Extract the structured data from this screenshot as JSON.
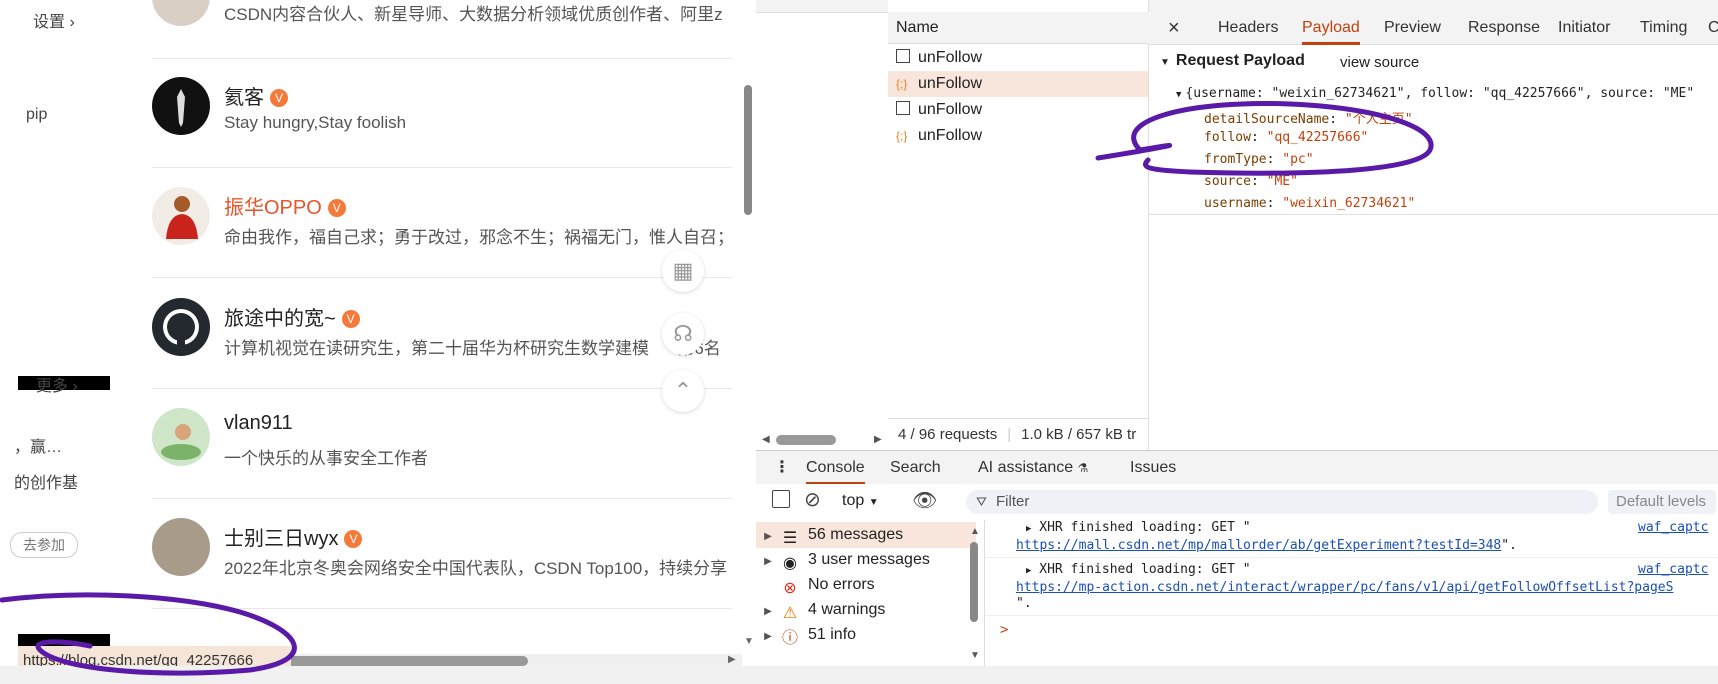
{
  "left_panel": {
    "settings_label": "设置",
    "pip_label": "pip",
    "more_label": "更多",
    "promo_text": "，赢…",
    "creation_text": "的创作基",
    "join_button": "去参加",
    "top_cut_text": "CSDN内容合伙人、新星导师、大数据分析领域优质创作者、阿里z"
  },
  "users": [
    {
      "name": "氦客",
      "desc": "Stay hungry,Stay foolish",
      "verified": true,
      "highlight": false
    },
    {
      "name": "振华OPPO",
      "desc": "命由我作，福自己求；勇于改过，邪念不生；祸福无门，惟人自召；",
      "verified": true,
      "highlight": true
    },
    {
      "name": "旅途中的宽~",
      "desc": "计算机视觉在读研究生，第二十届华为杯研究生数学建模",
      "desc_suffix": "第6名",
      "verified": true,
      "highlight": false
    },
    {
      "name": "vlan911",
      "desc": "一个快乐的从事安全工作者",
      "verified": false,
      "highlight": false
    },
    {
      "name": "士别三日wyx",
      "desc": "2022年北京冬奥会网络安全中国代表队，CSDN Top100，持续分享",
      "verified": true,
      "highlight": false
    }
  ],
  "status_url": "https://blog.csdn.net/qq_42257666",
  "devtools": {
    "network": {
      "name_header": "Name",
      "requests": [
        {
          "name": "unFollow",
          "type": "doc"
        },
        {
          "name": "unFollow",
          "type": "xhr"
        },
        {
          "name": "unFollow",
          "type": "doc"
        },
        {
          "name": "unFollow",
          "type": "xhr"
        }
      ],
      "footer_requests": "4 / 96 requests",
      "footer_size": "1.0 kB / 657 kB tr"
    },
    "detail_tabs": [
      "Headers",
      "Payload",
      "Preview",
      "Response",
      "Initiator",
      "Timing",
      "C"
    ],
    "active_detail_tab": "Payload",
    "payload": {
      "title": "Request Payload",
      "view_source": "view source",
      "summary": "{username: \"weixin_62734621\", follow: \"qq_42257666\", source: \"ME\"",
      "fields": [
        {
          "key": "detailSourceName",
          "value": "\"个人主页\""
        },
        {
          "key": "follow",
          "value": "\"qq_42257666\""
        },
        {
          "key": "fromType",
          "value": "\"pc\""
        },
        {
          "key": "source",
          "value": "\"ME\""
        },
        {
          "key": "username",
          "value": "\"weixin_62734621\""
        }
      ]
    },
    "console": {
      "tabs": [
        "Console",
        "Search",
        "AI assistance",
        "Issues"
      ],
      "context": "top",
      "filter_placeholder": "Filter",
      "default_levels": "Default levels",
      "sidebar": [
        {
          "label": "56 messages",
          "icon": "list-icon"
        },
        {
          "label": "3 user messages",
          "icon": "user-icon"
        },
        {
          "label": "No errors",
          "icon": "error-icon"
        },
        {
          "label": "4 warnings",
          "icon": "warning-icon"
        },
        {
          "label": "51 info",
          "icon": "info-icon"
        }
      ],
      "logs": [
        {
          "text": "XHR finished loading: GET \"",
          "url": "https://mall.csdn.net/mp/mallorder/ab/getExperiment?testId=348",
          "suffix": "\".",
          "source": "waf_captc"
        },
        {
          "text": "XHR finished loading: GET \"",
          "url": "https://mp-action.csdn.net/interact/wrapper/pc/fans/v1/api/getFollowOffsetList?pageS",
          "suffix": "\".",
          "source": "waf_captc"
        }
      ],
      "prompt": ">"
    }
  },
  "colors": {
    "accent": "#c2410c",
    "annotation": "#5a1aa8",
    "verified": "#f5793a"
  }
}
